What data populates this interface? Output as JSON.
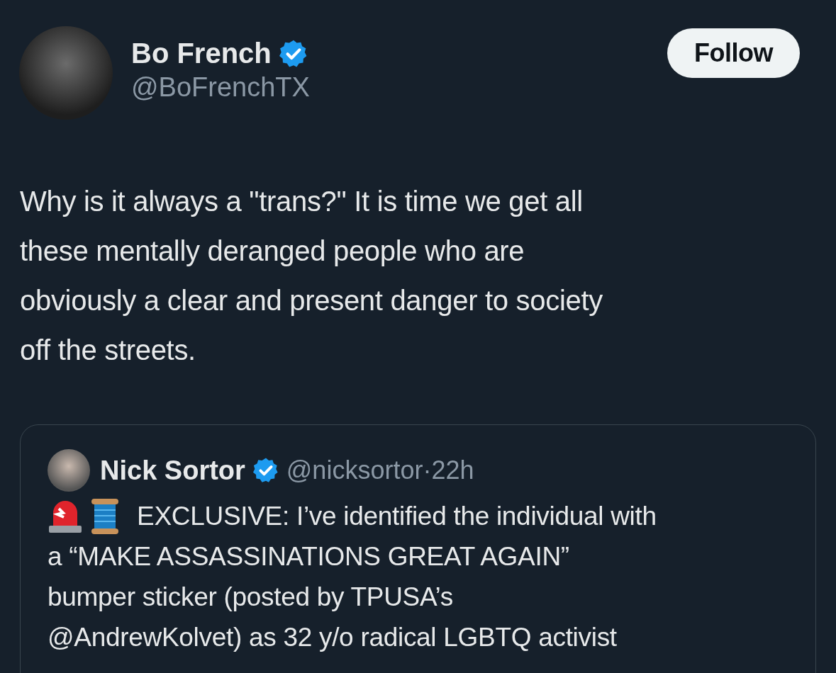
{
  "author": {
    "name": "Bo French",
    "handle": "@BoFrenchTX",
    "verified": true
  },
  "follow_button": {
    "label": "Follow"
  },
  "text_lines": [
    "Why is it always a \"trans?\" It is time we get all",
    "these mentally deranged people who are",
    "obviously a clear and present danger to society",
    "off the streets."
  ],
  "quoted": {
    "name": "Nick Sortor",
    "verified": true,
    "handle": "@nicksortor",
    "separator": "·",
    "time": "22h",
    "text_lines": [
      "EXCLUSIVE: I’ve identified the individual with",
      "a “MAKE ASSASSINATIONS GREAT AGAIN”",
      "bumper sticker (posted by TPUSA’s",
      "@AndrewKolvet) as 32 y/o radical LGBTQ activist"
    ]
  }
}
